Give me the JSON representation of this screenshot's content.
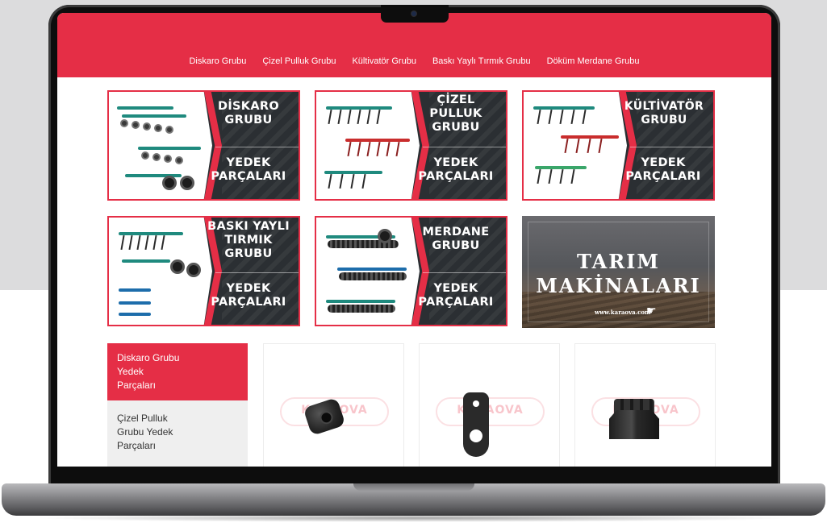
{
  "nav": {
    "items": [
      {
        "label": "Diskaro Grubu"
      },
      {
        "label": "Çizel Pulluk Grubu"
      },
      {
        "label": "Kültivatör Grubu"
      },
      {
        "label": "Baskı Yaylı Tırmık Grubu"
      },
      {
        "label": "Döküm Merdane Grubu"
      }
    ]
  },
  "banners": [
    {
      "title_lines": [
        "DİSKARO",
        "GRUBU"
      ],
      "sub_lines": [
        "YEDEK",
        "PARÇALARI"
      ],
      "machine_color": "teal"
    },
    {
      "title_lines": [
        "ÇİZEL",
        "PULLUK",
        "GRUBU"
      ],
      "sub_lines": [
        "YEDEK",
        "PARÇALARI"
      ],
      "machine_color": "red"
    },
    {
      "title_lines": [
        "KÜLTİVATÖR",
        "GRUBU"
      ],
      "sub_lines": [
        "YEDEK",
        "PARÇALARI"
      ],
      "machine_color": "teal"
    },
    {
      "title_lines": [
        "BASKI YAYLI",
        "TIRMIK",
        "GRUBU"
      ],
      "sub_lines": [
        "YEDEK",
        "PARÇALARI"
      ],
      "machine_color": "blue"
    },
    {
      "title_lines": [
        "MERDANE",
        "GRUBU"
      ],
      "sub_lines": [
        "YEDEK",
        "PARÇALARI"
      ],
      "machine_color": "teal"
    }
  ],
  "promo": {
    "line1": "TARIM",
    "line2": "MAKİNALARI",
    "url": "www.karaova.com",
    "icon": "pointing-hand-icon"
  },
  "sidebar": {
    "items": [
      {
        "label": "Diskaro Grubu Yedek Parçaları",
        "lines": [
          "Diskaro Grubu",
          "Yedek",
          "Parçaları"
        ],
        "active": true
      },
      {
        "label": "Çizel Pulluk Grubu Yedek Parçaları",
        "lines": [
          "Çizel Pulluk",
          "Grubu Yedek",
          "Parçaları"
        ],
        "active": false
      }
    ]
  },
  "products": [
    {
      "image": "bushing-part",
      "watermark": "KARAOVA"
    },
    {
      "image": "washer-part",
      "watermark": "KARAOVA"
    },
    {
      "image": "castle-nut-part",
      "watermark": "KARAOVA"
    }
  ],
  "colors": {
    "brand_red": "#e52e46",
    "banner_dark": "#2b2f33",
    "sidebar_inactive": "#efefef"
  }
}
